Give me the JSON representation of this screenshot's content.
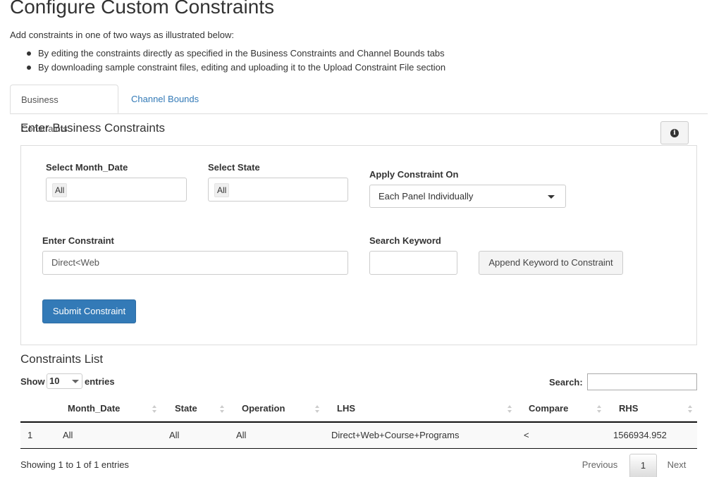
{
  "page": {
    "title": "Configure Custom Constraints",
    "intro": "Add constraints in one of two ways as illustrated below:",
    "bullets": [
      "By editing the constraints directly as specified in the Business Constraints and Channel Bounds tabs",
      "By downloading sample constraint files, editing and uploading it to the Upload Constraint File section"
    ]
  },
  "tabs": [
    {
      "label": "Business Constraints",
      "active": true
    },
    {
      "label": "Channel Bounds",
      "active": false
    }
  ],
  "form": {
    "heading": "Enter Business Constraints",
    "info_icon": "info-circle-icon",
    "month_date": {
      "label": "Select Month_Date",
      "value": "All"
    },
    "state": {
      "label": "Select State",
      "value": "All"
    },
    "apply_on": {
      "label": "Apply Constraint On",
      "value": "Each Panel Individually"
    },
    "constraint": {
      "label": "Enter Constraint",
      "value": "Direct<Web"
    },
    "keyword": {
      "label": "Search Keyword",
      "value": ""
    },
    "append_button": "Append Keyword to Constraint",
    "submit_button": "Submit Constraint"
  },
  "list": {
    "heading": "Constraints List",
    "show_prefix": "Show",
    "entries_value": "10",
    "show_suffix": "entries",
    "search_label": "Search:",
    "columns": [
      "Month_Date",
      "State",
      "Operation",
      "LHS",
      "Compare",
      "RHS"
    ],
    "rows": [
      {
        "index": "1",
        "month_date": "All",
        "state": "All",
        "operation": "All",
        "lhs": "Direct+Web+Course+Programs",
        "compare": "<",
        "rhs": "1566934.952"
      }
    ],
    "info": "Showing 1 to 1 of 1 entries",
    "pagination": {
      "previous": "Previous",
      "current": "1",
      "next": "Next"
    }
  },
  "colors": {
    "link": "#337ab7",
    "primary": "#337ab7"
  }
}
